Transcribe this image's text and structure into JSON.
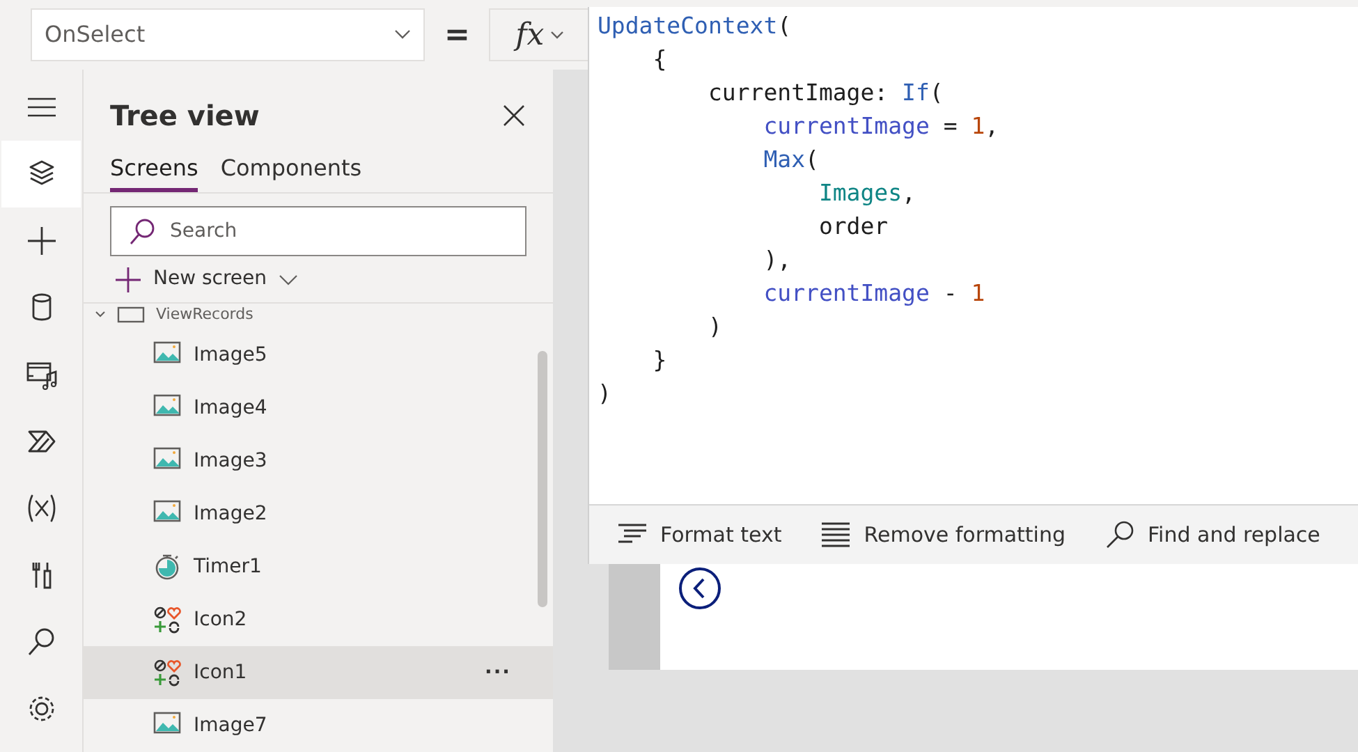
{
  "property_bar": {
    "property": "OnSelect",
    "equals": "=",
    "fx": "fx"
  },
  "rail": [
    {
      "kind": "menu",
      "selected": false
    },
    {
      "kind": "layers",
      "selected": true
    },
    {
      "kind": "plus",
      "selected": false
    },
    {
      "kind": "data",
      "selected": false
    },
    {
      "kind": "media",
      "selected": false
    },
    {
      "kind": "automate",
      "selected": false
    },
    {
      "kind": "variables",
      "selected": false
    },
    {
      "kind": "tools",
      "selected": false
    },
    {
      "kind": "search",
      "selected": false
    },
    {
      "kind": "settings",
      "selected": false
    }
  ],
  "tree_view": {
    "title": "Tree view",
    "tabs": [
      {
        "label": "Screens",
        "selected": true
      },
      {
        "label": "Components",
        "selected": false
      }
    ],
    "search": {
      "placeholder": "Search"
    },
    "new_screen": "New screen",
    "screen": {
      "label": "ViewRecords",
      "expanded": true,
      "children": [
        {
          "label": "Image5",
          "kind": "image",
          "selected": false
        },
        {
          "label": "Image4",
          "kind": "image",
          "selected": false
        },
        {
          "label": "Image3",
          "kind": "image",
          "selected": false
        },
        {
          "label": "Image2",
          "kind": "image",
          "selected": false
        },
        {
          "label": "Timer1",
          "kind": "timer",
          "selected": false
        },
        {
          "label": "Icon2",
          "kind": "icon",
          "selected": false
        },
        {
          "label": "Icon1",
          "kind": "icon",
          "selected": true,
          "more": "···"
        },
        {
          "label": "Image7",
          "kind": "image",
          "selected": false
        }
      ]
    }
  },
  "formula_editor": {
    "lines": [
      {
        "tokens": [
          {
            "kind": "function",
            "text": "UpdateContext"
          },
          {
            "kind": "plain",
            "text": "("
          }
        ],
        "children": [
          {
            "tokens": [
              {
                "kind": "plain",
                "text": "{"
              }
            ],
            "children": [
              {
                "tokens": [
                  {
                    "kind": "plain",
                    "text": "currentImage: "
                  },
                  {
                    "kind": "function",
                    "text": "If"
                  },
                  {
                    "kind": "plain",
                    "text": "("
                  }
                ],
                "children": [
                  {
                    "tokens": [
                      {
                        "kind": "variable",
                        "text": "currentImage"
                      },
                      {
                        "kind": "plain",
                        "text": " = "
                      },
                      {
                        "kind": "number",
                        "text": "1"
                      },
                      {
                        "kind": "plain",
                        "text": ","
                      }
                    ]
                  },
                  {
                    "tokens": [
                      {
                        "kind": "function",
                        "text": "Max"
                      },
                      {
                        "kind": "plain",
                        "text": "("
                      }
                    ],
                    "children": [
                      {
                        "tokens": [
                          {
                            "kind": "table",
                            "text": "Images"
                          },
                          {
                            "kind": "plain",
                            "text": ","
                          }
                        ]
                      },
                      {
                        "tokens": [
                          {
                            "kind": "plain",
                            "text": "order"
                          }
                        ]
                      }
                    ]
                  },
                  {
                    "tokens": [
                      {
                        "kind": "plain",
                        "text": "),"
                      }
                    ]
                  },
                  {
                    "tokens": [
                      {
                        "kind": "variable",
                        "text": "currentImage"
                      },
                      {
                        "kind": "plain",
                        "text": " - "
                      },
                      {
                        "kind": "number",
                        "text": "1"
                      }
                    ]
                  }
                ]
              },
              {
                "tokens": [
                  {
                    "kind": "plain",
                    "text": ")"
                  }
                ]
              }
            ]
          },
          {
            "tokens": [
              {
                "kind": "plain",
                "text": "}"
              }
            ]
          }
        ]
      },
      {
        "tokens": [
          {
            "kind": "plain",
            "text": ")"
          }
        ]
      }
    ],
    "toolbar": [
      {
        "kind": "format",
        "label": "Format text"
      },
      {
        "kind": "remove",
        "label": "Remove formatting"
      },
      {
        "kind": "find",
        "label": "Find and replace"
      }
    ]
  }
}
